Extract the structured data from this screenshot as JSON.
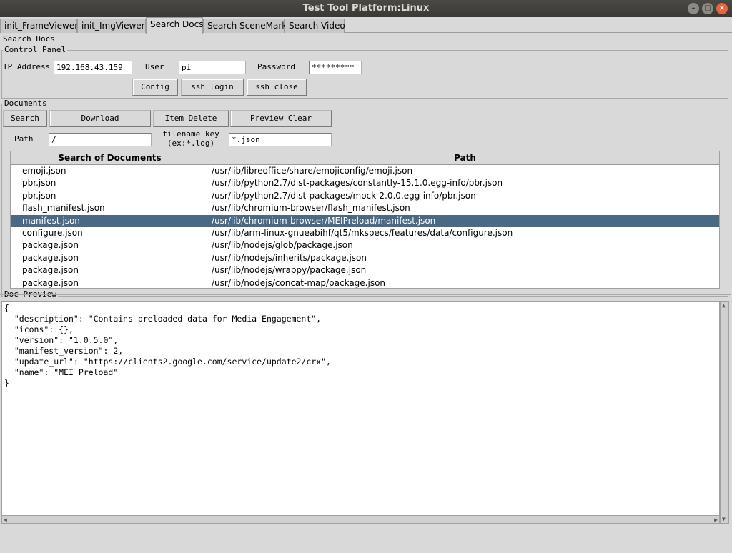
{
  "window": {
    "title": "Test Tool Platform:Linux",
    "controls": {
      "min": "–",
      "max": "□",
      "close": "×"
    }
  },
  "tabs": [
    "init_FrameViewer",
    "init_ImgViewer",
    "Search Docs",
    "Search SceneMark",
    "Search Video"
  ],
  "active_tab": "Search Docs",
  "page_label": "Search Docs",
  "control_panel": {
    "title": "Control Panel",
    "ip_label": "IP Address",
    "ip_value": "192.168.43.159",
    "user_label": "User",
    "user_value": "pi",
    "password_label": "Password",
    "password_value": "*********",
    "buttons": {
      "config": "Config",
      "ssh_login": "ssh_login",
      "ssh_close": "ssh_close"
    }
  },
  "documents": {
    "title": "Documents",
    "buttons": {
      "search": "Search",
      "download": "Download",
      "item_delete": "Item Delete",
      "preview_clear": "Preview Clear"
    },
    "path_label": "Path",
    "path_value": "/",
    "key_label_1": "filename key",
    "key_label_2": "(ex:*.log)",
    "key_value": "*.json"
  },
  "results": {
    "columns": [
      "Search of Documents",
      "Path"
    ],
    "rows": [
      {
        "name": "emoji.json",
        "path": "/usr/lib/libreoffice/share/emojiconfig/emoji.json"
      },
      {
        "name": "pbr.json",
        "path": "/usr/lib/python2.7/dist-packages/constantly-15.1.0.egg-info/pbr.json"
      },
      {
        "name": "pbr.json",
        "path": "/usr/lib/python2.7/dist-packages/mock-2.0.0.egg-info/pbr.json"
      },
      {
        "name": "flash_manifest.json",
        "path": "/usr/lib/chromium-browser/flash_manifest.json"
      },
      {
        "name": "manifest.json",
        "path": "/usr/lib/chromium-browser/MEIPreload/manifest.json"
      },
      {
        "name": "configure.json",
        "path": "/usr/lib/arm-linux-gnueabihf/qt5/mkspecs/features/data/configure.json"
      },
      {
        "name": "package.json",
        "path": "/usr/lib/nodejs/glob/package.json"
      },
      {
        "name": "package.json",
        "path": "/usr/lib/nodejs/inherits/package.json"
      },
      {
        "name": "package.json",
        "path": "/usr/lib/nodejs/wrappy/package.json"
      },
      {
        "name": "package.json",
        "path": "/usr/lib/nodejs/concat-map/package.json"
      }
    ],
    "selected_index": 4
  },
  "preview": {
    "title": "Doc Preview",
    "content": "{\n  \"description\": \"Contains preloaded data for Media Engagement\",\n  \"icons\": {},\n  \"version\": \"1.0.5.0\",\n  \"manifest_version\": 2,\n  \"update_url\": \"https://clients2.google.com/service/update2/crx\",\n  \"name\": \"MEI Preload\"\n}"
  }
}
